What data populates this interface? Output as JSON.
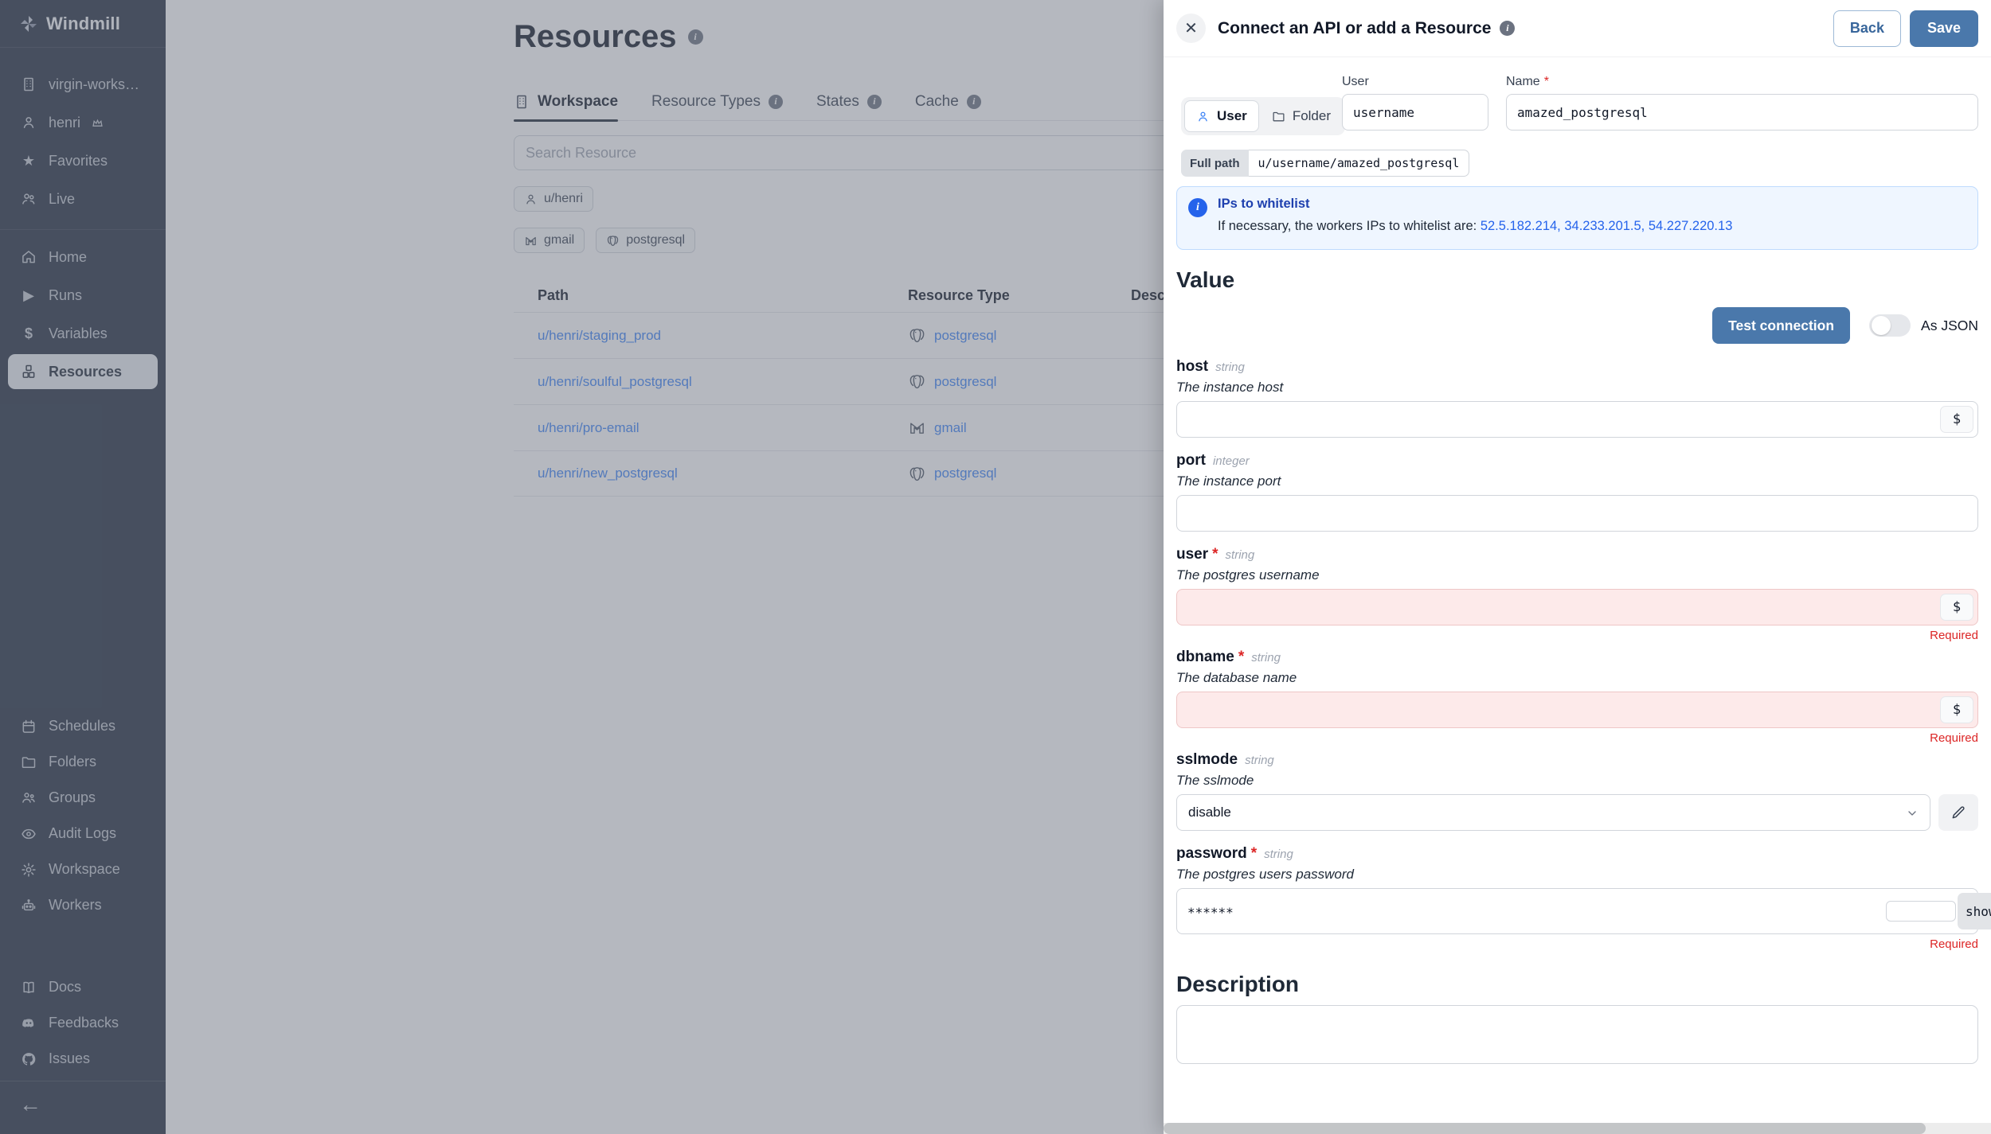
{
  "colors": {
    "accent": "#4a78ab",
    "link": "#2563eb",
    "error": "#dc2626",
    "info_bg": "#eff6ff"
  },
  "sidebar": {
    "logo": "Windmill",
    "workspace_items": [
      {
        "label": "virgin-worksp..."
      },
      {
        "label": "henri"
      },
      {
        "label": "Favorites"
      },
      {
        "label": "Live"
      }
    ],
    "nav_items": [
      {
        "label": "Home"
      },
      {
        "label": "Runs"
      },
      {
        "label": "Variables"
      },
      {
        "label": "Resources"
      }
    ],
    "admin_items": [
      {
        "label": "Schedules"
      },
      {
        "label": "Folders"
      },
      {
        "label": "Groups"
      },
      {
        "label": "Audit Logs"
      },
      {
        "label": "Workspace"
      },
      {
        "label": "Workers"
      }
    ],
    "meta_items": [
      {
        "label": "Docs"
      },
      {
        "label": "Feedbacks"
      },
      {
        "label": "Issues"
      }
    ]
  },
  "main": {
    "title": "Resources",
    "tabs": [
      {
        "label": "Workspace"
      },
      {
        "label": "Resource Types"
      },
      {
        "label": "States"
      },
      {
        "label": "Cache"
      }
    ],
    "search_placeholder": "Search Resource",
    "owner_filter": "u/henri",
    "type_filters": [
      {
        "label": "gmail"
      },
      {
        "label": "postgresql"
      }
    ],
    "table": {
      "headers": [
        "Path",
        "Resource Type",
        "Description"
      ],
      "rows": [
        {
          "path": "u/henri/staging_prod",
          "type": "postgresql"
        },
        {
          "path": "u/henri/soulful_postgresql",
          "type": "postgresql"
        },
        {
          "path": "u/henri/pro-email",
          "type": "gmail"
        },
        {
          "path": "u/henri/new_postgresql",
          "type": "postgresql"
        }
      ]
    }
  },
  "drawer": {
    "title": "Connect an API or add a Resource",
    "back_label": "Back",
    "save_label": "Save",
    "owner_toggle": {
      "user": "User",
      "folder": "Folder"
    },
    "user_field": {
      "label": "User",
      "value": "username"
    },
    "name_field": {
      "label": "Name",
      "required_mark": "*",
      "value": "amazed_postgresql"
    },
    "full_path": {
      "label": "Full path",
      "value": "u/username/amazed_postgresql"
    },
    "whitelist": {
      "title": "IPs to whitelist",
      "text": "If necessary, the workers IPs to whitelist are:",
      "ips": "52.5.182.214, 34.233.201.5, 54.227.220.13"
    },
    "value_heading": "Value",
    "test_connection_label": "Test connection",
    "as_json_label": "As JSON",
    "dollar_label": "$",
    "required_label": "Required",
    "fields": {
      "host": {
        "name": "host",
        "type": "string",
        "desc": "The instance host"
      },
      "port": {
        "name": "port",
        "type": "integer",
        "desc": "The instance port"
      },
      "user": {
        "name": "user",
        "type": "string",
        "desc": "The postgres username",
        "required_mark": "*"
      },
      "dbname": {
        "name": "dbname",
        "type": "string",
        "desc": "The database name",
        "required_mark": "*"
      },
      "sslmode": {
        "name": "sslmode",
        "type": "string",
        "desc": "The sslmode",
        "value": "disable"
      },
      "password": {
        "name": "password",
        "type": "string",
        "desc": "The postgres users password",
        "required_mark": "*",
        "value": "******",
        "show_label": "show"
      }
    },
    "description_heading": "Description"
  }
}
